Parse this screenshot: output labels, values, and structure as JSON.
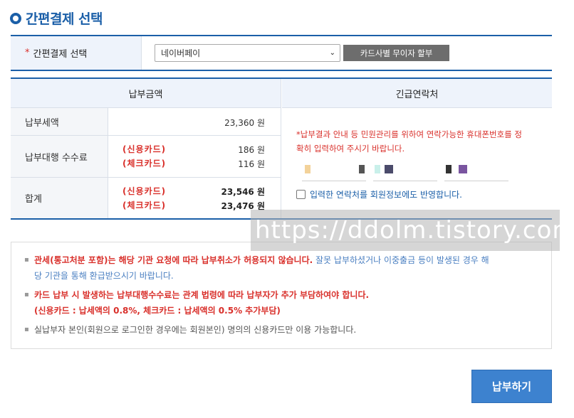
{
  "section": {
    "title": "간편결제 선택"
  },
  "select_row": {
    "required_mark": "*",
    "label": "간편결제 선택",
    "selected_value": "네이버페이",
    "installment_button": "카드사별 무이자 할부"
  },
  "amount_table": {
    "header": "납부금액",
    "rows": {
      "tax": {
        "label": "납부세액",
        "amount": "23,360 원"
      },
      "fee": {
        "label": "납부대행 수수료",
        "credit_label": "(신용카드)",
        "credit_amount": "186 원",
        "check_label": "(체크카드)",
        "check_amount": "116 원"
      },
      "total": {
        "label": "합계",
        "credit_label": "(신용카드)",
        "credit_amount": "23,546 원",
        "check_label": "(체크카드)",
        "check_amount": "23,476 원"
      }
    }
  },
  "contact": {
    "header": "긴급연락처",
    "note_line1": "*납부결과 안내 등 민원관리를 위하여 연락가능한 휴대폰번호를 정",
    "note_line2": "확히 입력하여 주시기 바랍니다.",
    "consent_label": "입력한 연락처를 회원정보에도 반영합니다."
  },
  "watermark": "https://ddolm.tistory.com",
  "notices": {
    "n1_red": "관세(통고처분 포함)는 해당 기관 요청에 따라 납부취소가 허용되지 않습니다.",
    "n1_blue_a": " 잘못 납부하셨거나 이중출금 등이 발생된 경우 해",
    "n1_blue_b": "당 기관을 통해 환급받으시기 바랍니다.",
    "n2_line1": "카드 납부 시 발생하는 납부대행수수료는 관계 법령에 따라 납부자가 추가 부담하여야 합니다.",
    "n2_line2": "(신용카드 : 납세액의 0.8%, 체크카드 : 납세액의 0.5% 추가부담)",
    "n3": "실납부자 본인(회원으로 로그인한 경우에는 회원본인) 명의의 신용카드만 이용 가능합니다."
  },
  "submit": {
    "label": "납부하기"
  },
  "colors": {
    "accent": "#1b5fa8",
    "warning": "#d9302b",
    "button": "#3d82cf"
  }
}
